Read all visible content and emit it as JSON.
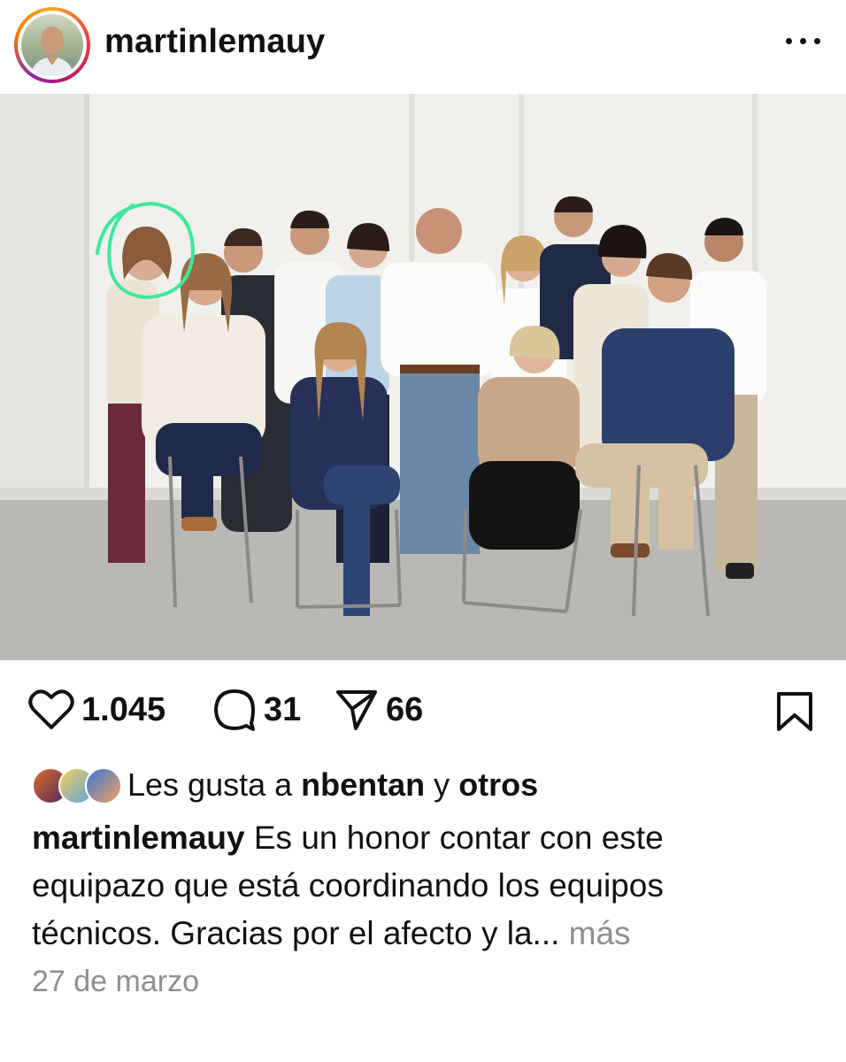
{
  "post": {
    "username": "martinlemauy",
    "stats": {
      "likes": "1.045",
      "comments": "31",
      "shares": "66"
    },
    "liked_by": {
      "prefix": "Les gusta a",
      "user": "nbentan",
      "connector": "y",
      "others": "otros"
    },
    "caption": {
      "user": "martinlemauy",
      "text": "Es un honor contar con este equipazo que está coordinando los equipos técnicos. Gracias por el afecto y la...",
      "more": "más"
    },
    "date": "27 de marzo"
  },
  "colors": {
    "text": "#111111",
    "muted": "#8e8e8e",
    "highlight_circle": "#3ee89a"
  },
  "icons": [
    "more-dots-icon",
    "heart-icon",
    "comment-icon",
    "share-icon",
    "bookmark-icon"
  ]
}
